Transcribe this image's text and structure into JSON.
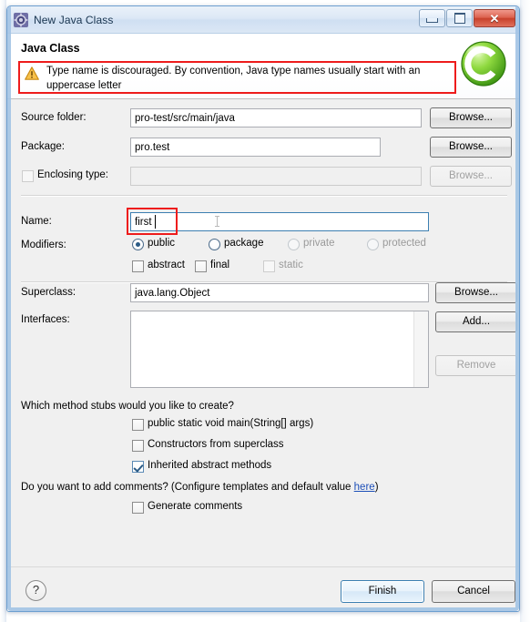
{
  "window": {
    "title": "New Java Class",
    "icon": "java-class-wizard-icon",
    "minimize_label": "Minimize",
    "maximize_label": "Maximize",
    "close_label": "Close"
  },
  "header": {
    "title": "Java Class",
    "message": "Type name is discouraged. By convention, Java type names usually start with an uppercase letter",
    "message_icon": "warning-icon",
    "banner_icon": "green-c-logo"
  },
  "fields": {
    "source_folder": {
      "label": "Source folder:",
      "value": "pro-test/src/main/java",
      "browse_label": "Browse..."
    },
    "package": {
      "label": "Package:",
      "value": "pro.test",
      "browse_label": "Browse..."
    },
    "enclosing_type": {
      "label": "Enclosing type:",
      "value": "",
      "checked": false,
      "browse_label": "Browse..."
    },
    "name": {
      "label": "Name:",
      "value": "first"
    },
    "superclass": {
      "label": "Superclass:",
      "value": "java.lang.Object",
      "browse_label": "Browse..."
    },
    "interfaces": {
      "label": "Interfaces:",
      "items": [],
      "add_label": "Add...",
      "remove_label": "Remove"
    }
  },
  "modifiers": {
    "label": "Modifiers:",
    "access": [
      {
        "label": "public",
        "selected": true,
        "enabled": true
      },
      {
        "label": "package",
        "selected": false,
        "enabled": true
      },
      {
        "label": "private",
        "selected": false,
        "enabled": false
      },
      {
        "label": "protected",
        "selected": false,
        "enabled": false
      }
    ],
    "flags": [
      {
        "label": "abstract",
        "checked": false,
        "enabled": true
      },
      {
        "label": "final",
        "checked": false,
        "enabled": true
      },
      {
        "label": "static",
        "checked": false,
        "enabled": false
      }
    ]
  },
  "stubs": {
    "question": "Which method stubs would you like to create?",
    "options": [
      {
        "label": "public static void main(String[] args)",
        "checked": false
      },
      {
        "label": "Constructors from superclass",
        "checked": false
      },
      {
        "label": "Inherited abstract methods",
        "checked": true
      }
    ]
  },
  "comments": {
    "question_prefix": "Do you want to add comments? (Configure templates and default value ",
    "link_label": "here",
    "question_suffix": ")",
    "option": {
      "label": "Generate comments",
      "checked": false
    }
  },
  "footer": {
    "help_label": "?",
    "finish_label": "Finish",
    "cancel_label": "Cancel"
  },
  "colors": {
    "error_outline": "#ee1c1c",
    "link": "#1d4fb8",
    "focus_border": "#3c7fb1",
    "warning": "#f0a714",
    "logo_green": "#5fc12a"
  }
}
